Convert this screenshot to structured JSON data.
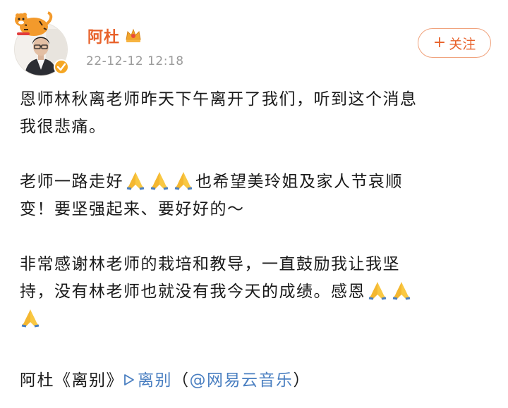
{
  "post": {
    "username": "阿杜",
    "timestamp": "22-12-12 12:18",
    "follow_label": "关注",
    "paragraphs": [
      {
        "lines": [
          "恩师林秋离老师昨天下午离开了我们，听到这个消息",
          "我很悲痛。"
        ]
      },
      {
        "line1_pre": "老师一路走好",
        "line1_post": "也希望美玲姐及家人节哀顺",
        "line2": "变！要坚强起来、要好好的～"
      },
      {
        "line1": "非常感谢林老师的栽培和教导，一直鼓励我让我坚",
        "line2_pre": "持，没有林老师也就没有我今天的成绩。感恩"
      }
    ],
    "music": {
      "prefix": "阿杜《离别》",
      "link_label": "离别",
      "source_open": "（",
      "source_link": "@网易云音乐",
      "source_close": "）"
    }
  },
  "colors": {
    "username": "#e8622b",
    "link": "#4a7fc1",
    "timestamp": "#9a9a9a"
  },
  "icons": [
    "tiger-badge-icon",
    "crown-icon",
    "verified-badge-icon",
    "praying-hands-icon",
    "play-icon"
  ]
}
